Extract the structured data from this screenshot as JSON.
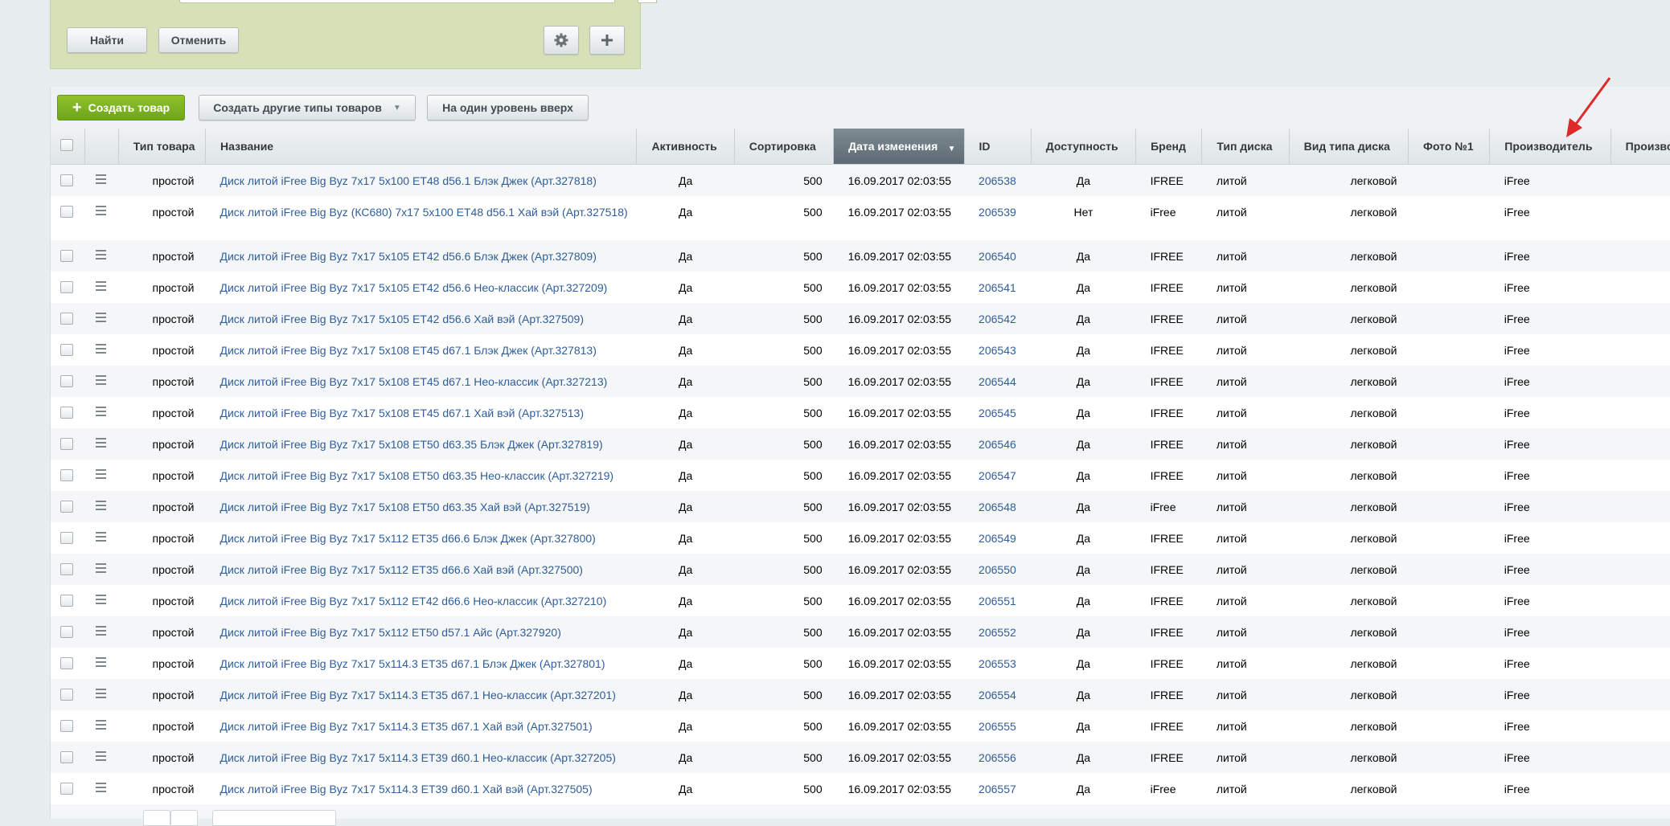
{
  "filter": {
    "find_label": "Найти",
    "cancel_label": "Отменить"
  },
  "toolbar": {
    "create_product": "Создать товар",
    "create_other_types": "Создать другие типы товаров",
    "level_up": "На один уровень вверх"
  },
  "colors": {
    "filter_bg": "#d6e1b8",
    "green_button": "#7bb221",
    "link": "#2f5e9b",
    "sorted_header": "#66737c",
    "annotation_arrow": "#e02a2a"
  },
  "columns": {
    "type": "Тип товара",
    "name": "Название",
    "active": "Активность",
    "sort": "Сортировка",
    "date": "Дата изменения",
    "id": "ID",
    "available": "Доступность",
    "brand": "Бренд",
    "disk_type": "Тип диска",
    "disk_kind": "Вид типа диска",
    "photo": "Фото №1",
    "maker": "Производитель",
    "maker2": "Произво"
  },
  "rows": [
    {
      "type": "простой",
      "name": "Диск литой iFree Big Byz 7x17 5x100 ET48 d56.1 Блэк Джек (Арт.327818)",
      "active": "Да",
      "sort": "500",
      "date": "16.09.2017 02:03:55",
      "id": "206538",
      "available": "Да",
      "brand": "IFREE",
      "disk_type": "литой",
      "disk_kind": "легковой",
      "maker": "iFree"
    },
    {
      "type": "простой",
      "name": "Диск литой iFree Big Byz (КС680) 7x17 5x100 ET48 d56.1 Хай вэй (Арт.327518)",
      "active": "Да",
      "sort": "500",
      "date": "16.09.2017 02:03:55",
      "id": "206539",
      "available": "Нет",
      "brand": "iFree",
      "disk_type": "литой",
      "disk_kind": "легковой",
      "maker": "iFree"
    },
    {
      "type": "простой",
      "name": "Диск литой iFree Big Byz 7x17 5x105 ET42 d56.6 Блэк Джек (Арт.327809)",
      "active": "Да",
      "sort": "500",
      "date": "16.09.2017 02:03:55",
      "id": "206540",
      "available": "Да",
      "brand": "IFREE",
      "disk_type": "литой",
      "disk_kind": "легковой",
      "maker": "iFree"
    },
    {
      "type": "простой",
      "name": "Диск литой iFree Big Byz 7x17 5x105 ET42 d56.6 Нео-классик (Арт.327209)",
      "active": "Да",
      "sort": "500",
      "date": "16.09.2017 02:03:55",
      "id": "206541",
      "available": "Да",
      "brand": "IFREE",
      "disk_type": "литой",
      "disk_kind": "легковой",
      "maker": "iFree"
    },
    {
      "type": "простой",
      "name": "Диск литой iFree Big Byz 7x17 5x105 ET42 d56.6 Хай вэй (Арт.327509)",
      "active": "Да",
      "sort": "500",
      "date": "16.09.2017 02:03:55",
      "id": "206542",
      "available": "Да",
      "brand": "IFREE",
      "disk_type": "литой",
      "disk_kind": "легковой",
      "maker": "iFree"
    },
    {
      "type": "простой",
      "name": "Диск литой iFree Big Byz 7x17 5x108 ET45 d67.1 Блэк Джек (Арт.327813)",
      "active": "Да",
      "sort": "500",
      "date": "16.09.2017 02:03:55",
      "id": "206543",
      "available": "Да",
      "brand": "IFREE",
      "disk_type": "литой",
      "disk_kind": "легковой",
      "maker": "iFree"
    },
    {
      "type": "простой",
      "name": "Диск литой iFree Big Byz 7x17 5x108 ET45 d67.1 Нео-классик (Арт.327213)",
      "active": "Да",
      "sort": "500",
      "date": "16.09.2017 02:03:55",
      "id": "206544",
      "available": "Да",
      "brand": "IFREE",
      "disk_type": "литой",
      "disk_kind": "легковой",
      "maker": "iFree"
    },
    {
      "type": "простой",
      "name": "Диск литой iFree Big Byz 7x17 5x108 ET45 d67.1 Хай вэй (Арт.327513)",
      "active": "Да",
      "sort": "500",
      "date": "16.09.2017 02:03:55",
      "id": "206545",
      "available": "Да",
      "brand": "IFREE",
      "disk_type": "литой",
      "disk_kind": "легковой",
      "maker": "iFree"
    },
    {
      "type": "простой",
      "name": "Диск литой iFree Big Byz 7x17 5x108 ET50 d63.35 Блэк Джек (Арт.327819)",
      "active": "Да",
      "sort": "500",
      "date": "16.09.2017 02:03:55",
      "id": "206546",
      "available": "Да",
      "brand": "IFREE",
      "disk_type": "литой",
      "disk_kind": "легковой",
      "maker": "iFree"
    },
    {
      "type": "простой",
      "name": "Диск литой iFree Big Byz 7x17 5x108 ET50 d63.35 Нео-классик (Арт.327219)",
      "active": "Да",
      "sort": "500",
      "date": "16.09.2017 02:03:55",
      "id": "206547",
      "available": "Да",
      "brand": "IFREE",
      "disk_type": "литой",
      "disk_kind": "легковой",
      "maker": "iFree"
    },
    {
      "type": "простой",
      "name": "Диск литой iFree Big Byz 7x17 5x108 ET50 d63.35 Хай вэй (Арт.327519)",
      "active": "Да",
      "sort": "500",
      "date": "16.09.2017 02:03:55",
      "id": "206548",
      "available": "Да",
      "brand": "iFree",
      "disk_type": "литой",
      "disk_kind": "легковой",
      "maker": "iFree"
    },
    {
      "type": "простой",
      "name": "Диск литой iFree Big Byz 7x17 5x112 ET35 d66.6 Блэк Джек (Арт.327800)",
      "active": "Да",
      "sort": "500",
      "date": "16.09.2017 02:03:55",
      "id": "206549",
      "available": "Да",
      "brand": "IFREE",
      "disk_type": "литой",
      "disk_kind": "легковой",
      "maker": "iFree"
    },
    {
      "type": "простой",
      "name": "Диск литой iFree Big Byz 7x17 5x112 ET35 d66.6 Хай вэй (Арт.327500)",
      "active": "Да",
      "sort": "500",
      "date": "16.09.2017 02:03:55",
      "id": "206550",
      "available": "Да",
      "brand": "IFREE",
      "disk_type": "литой",
      "disk_kind": "легковой",
      "maker": "iFree"
    },
    {
      "type": "простой",
      "name": "Диск литой iFree Big Byz 7x17 5x112 ET42 d66.6 Нео-классик (Арт.327210)",
      "active": "Да",
      "sort": "500",
      "date": "16.09.2017 02:03:55",
      "id": "206551",
      "available": "Да",
      "brand": "IFREE",
      "disk_type": "литой",
      "disk_kind": "легковой",
      "maker": "iFree"
    },
    {
      "type": "простой",
      "name": "Диск литой iFree Big Byz 7x17 5x112 ET50 d57.1 Айс (Арт.327920)",
      "active": "Да",
      "sort": "500",
      "date": "16.09.2017 02:03:55",
      "id": "206552",
      "available": "Да",
      "brand": "IFREE",
      "disk_type": "литой",
      "disk_kind": "легковой",
      "maker": "iFree"
    },
    {
      "type": "простой",
      "name": "Диск литой iFree Big Byz 7x17 5x114.3 ET35 d67.1 Блэк Джек (Арт.327801)",
      "active": "Да",
      "sort": "500",
      "date": "16.09.2017 02:03:55",
      "id": "206553",
      "available": "Да",
      "brand": "IFREE",
      "disk_type": "литой",
      "disk_kind": "легковой",
      "maker": "iFree"
    },
    {
      "type": "простой",
      "name": "Диск литой iFree Big Byz 7x17 5x114.3 ET35 d67.1 Нео-классик (Арт.327201)",
      "active": "Да",
      "sort": "500",
      "date": "16.09.2017 02:03:55",
      "id": "206554",
      "available": "Да",
      "brand": "IFREE",
      "disk_type": "литой",
      "disk_kind": "легковой",
      "maker": "iFree"
    },
    {
      "type": "простой",
      "name": "Диск литой iFree Big Byz 7x17 5x114.3 ET35 d67.1 Хай вэй (Арт.327501)",
      "active": "Да",
      "sort": "500",
      "date": "16.09.2017 02:03:55",
      "id": "206555",
      "available": "Да",
      "brand": "IFREE",
      "disk_type": "литой",
      "disk_kind": "легковой",
      "maker": "iFree"
    },
    {
      "type": "простой",
      "name": "Диск литой iFree Big Byz 7x17 5x114.3 ET39 d60.1 Нео-классик (Арт.327205)",
      "active": "Да",
      "sort": "500",
      "date": "16.09.2017 02:03:55",
      "id": "206556",
      "available": "Да",
      "brand": "IFREE",
      "disk_type": "литой",
      "disk_kind": "легковой",
      "maker": "iFree"
    },
    {
      "type": "простой",
      "name": "Диск литой iFree Big Byz 7x17 5x114.3 ET39 d60.1 Хай вэй (Арт.327505)",
      "active": "Да",
      "sort": "500",
      "date": "16.09.2017 02:03:55",
      "id": "206557",
      "available": "Да",
      "brand": "iFree",
      "disk_type": "литой",
      "disk_kind": "легковой",
      "maker": "iFree"
    }
  ]
}
